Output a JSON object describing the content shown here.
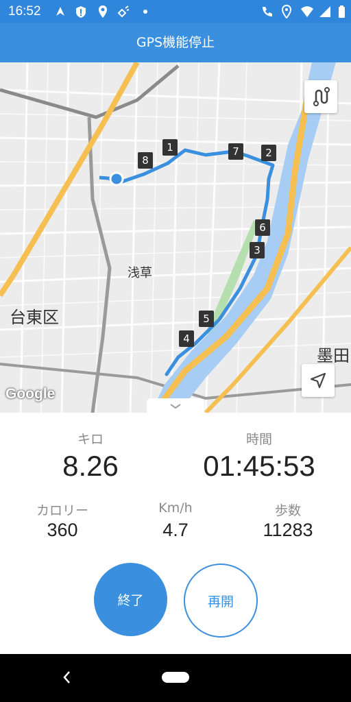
{
  "status_bar": {
    "time": "16:52"
  },
  "app_bar": {
    "title": "GPS機能停止"
  },
  "map": {
    "labels": {
      "asakusa": "浅草",
      "taito": "台東区",
      "sumida": "墨田"
    },
    "attribution": "Google",
    "markers": [
      "1",
      "2",
      "3",
      "4",
      "5",
      "6",
      "7",
      "8"
    ],
    "route_color": "#3a8fdf"
  },
  "stats": {
    "distance": {
      "label": "キロ",
      "value": "8.26"
    },
    "time": {
      "label": "時間",
      "value": "01:45:53"
    },
    "calories": {
      "label": "カロリー",
      "value": "360"
    },
    "speed": {
      "label": "Km/h",
      "value": "4.7"
    },
    "steps": {
      "label": "歩数",
      "value": "11283"
    }
  },
  "buttons": {
    "end_label": "終了",
    "resume_label": "再開"
  },
  "icons": {
    "status": [
      "navigation-arrow-icon",
      "alert-icon",
      "location-pin-icon",
      "satellite-icon",
      "dot-icon",
      "phone-signal-icon",
      "location-pin-icon",
      "wifi-icon",
      "signal-icon",
      "battery-icon"
    ],
    "map": [
      "route-icon",
      "my-location-arrow-icon"
    ],
    "nav": [
      "back-icon",
      "home-pill-icon"
    ]
  },
  "colors": {
    "primary": "#3a8fdf",
    "status_bar": "#2f86da",
    "river": "#a7cdf4",
    "highway": "#f6bf52"
  }
}
